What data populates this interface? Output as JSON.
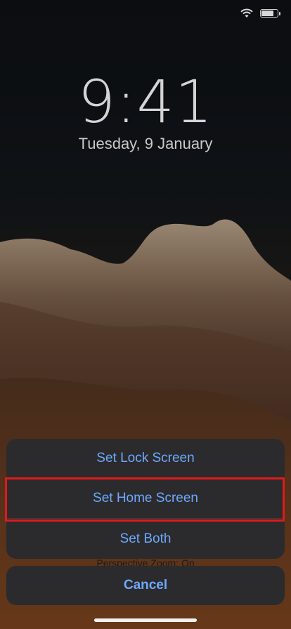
{
  "lock_screen": {
    "time": "9:41",
    "date": "Tuesday, 9 January"
  },
  "status_bar": {
    "wifi_icon": "wifi-icon",
    "battery_icon": "battery-icon",
    "battery_level": 0.8
  },
  "action_sheet": {
    "items": [
      {
        "label": "Set Lock Screen"
      },
      {
        "label": "Set Home Screen",
        "highlighted": true
      },
      {
        "label": "Set Both"
      }
    ],
    "perspective_zoom": "Perspective Zoom: On",
    "cancel_label": "Cancel"
  },
  "colors": {
    "action_text": "#6ea8ff",
    "highlight_border": "#e01a1a",
    "sheet_bg": "#2b2b2d"
  }
}
